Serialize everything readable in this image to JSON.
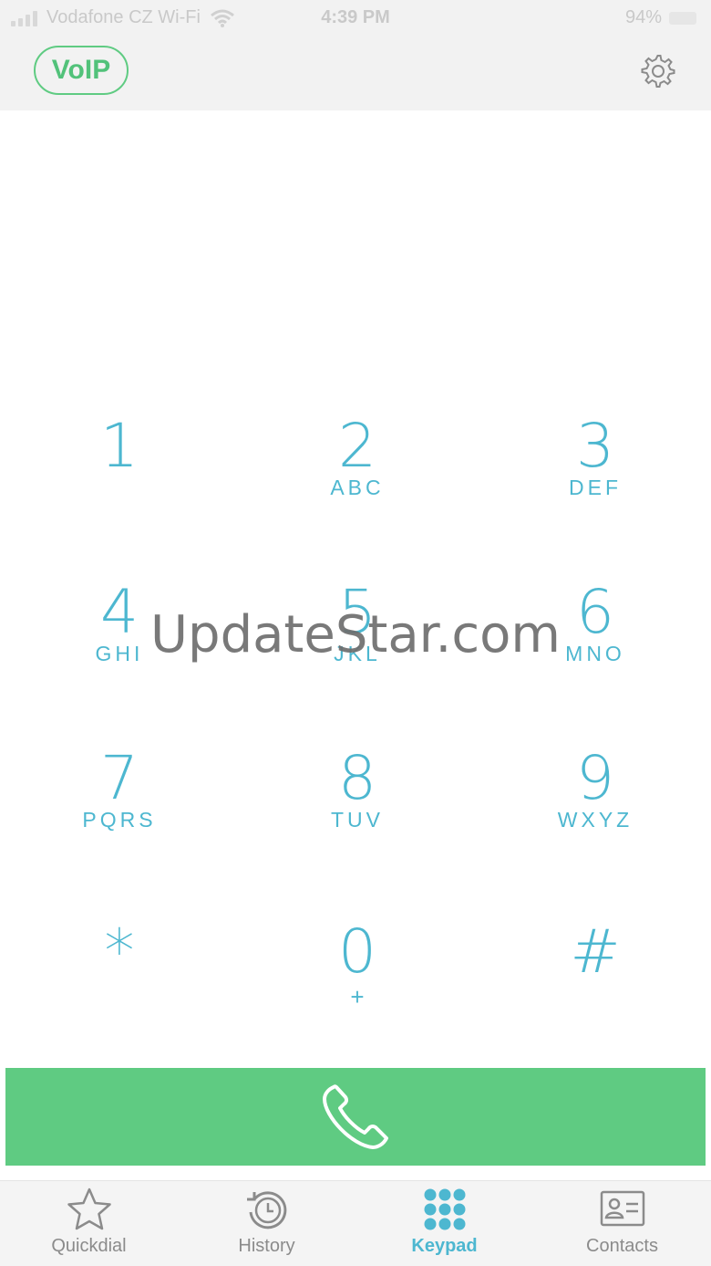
{
  "status_bar": {
    "carrier": "Vodafone CZ Wi-Fi",
    "time": "4:39 PM",
    "battery": "94%"
  },
  "header": {
    "badge": "VoIP"
  },
  "keypad": {
    "keys": [
      {
        "digit": "1",
        "letters": ""
      },
      {
        "digit": "2",
        "letters": "ABC"
      },
      {
        "digit": "3",
        "letters": "DEF"
      },
      {
        "digit": "4",
        "letters": "GHI"
      },
      {
        "digit": "5",
        "letters": "JKL"
      },
      {
        "digit": "6",
        "letters": "MNO"
      },
      {
        "digit": "7",
        "letters": "PQRS"
      },
      {
        "digit": "8",
        "letters": "TUV"
      },
      {
        "digit": "9",
        "letters": "WXYZ"
      },
      {
        "digit": "*",
        "letters": ""
      },
      {
        "digit": "0",
        "letters": "+"
      },
      {
        "digit": "#",
        "letters": ""
      }
    ]
  },
  "watermark": "UpdateStar.com",
  "tabs": [
    {
      "label": "Quickdial",
      "icon": "star-icon",
      "active": false
    },
    {
      "label": "History",
      "icon": "history-icon",
      "active": false
    },
    {
      "label": "Keypad",
      "icon": "keypad-icon",
      "active": true
    },
    {
      "label": "Contacts",
      "icon": "contact-card-icon",
      "active": false
    }
  ],
  "colors": {
    "accent": "#4db7d0",
    "call_green": "#5fcb82",
    "tab_inactive": "#8b8b8b"
  }
}
